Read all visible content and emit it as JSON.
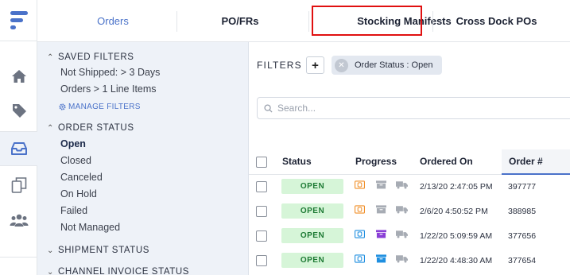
{
  "tabs": [
    {
      "label": "Orders",
      "active": true
    },
    {
      "label": "PO/FRs",
      "active": false
    },
    {
      "label": "Stocking Manifests",
      "active": false,
      "highlighted": true
    },
    {
      "label": "Cross Dock POs",
      "active": false
    }
  ],
  "rail": {
    "items": [
      {
        "icon": "home-icon"
      },
      {
        "icon": "tag-icon"
      },
      {
        "icon": "inbox-icon",
        "active": true
      },
      {
        "icon": "copy-icon"
      },
      {
        "icon": "users-icon"
      }
    ]
  },
  "sidebar": {
    "saved_filters": {
      "title": "SAVED FILTERS",
      "items": [
        "Not Shipped: > 3 Days",
        "Orders > 1 Line Items"
      ],
      "manage_label": "MANAGE FILTERS"
    },
    "order_status": {
      "title": "ORDER STATUS",
      "items": [
        "Open",
        "Closed",
        "Canceled",
        "On Hold",
        "Failed",
        "Not Managed"
      ],
      "selected": "Open"
    },
    "shipment_status": {
      "title": "SHIPMENT STATUS"
    },
    "channel_invoice_status": {
      "title": "CHANNEL INVOICE STATUS"
    }
  },
  "main": {
    "filters_label": "FILTERS",
    "add_label": "+",
    "chip_label": "Order Status : Open",
    "search_placeholder": "Search..."
  },
  "table": {
    "headers": {
      "status": "Status",
      "progress": "Progress",
      "ordered_on": "Ordered On",
      "order_num": "Order #"
    },
    "rows": [
      {
        "status": "OPEN",
        "ordered_on": "2/13/20 2:47:05 PM",
        "order_num": "397777",
        "progress": [
          "orange",
          "gray",
          "gray"
        ]
      },
      {
        "status": "OPEN",
        "ordered_on": "2/6/20 4:50:52 PM",
        "order_num": "388985",
        "progress": [
          "orange",
          "gray",
          "gray"
        ]
      },
      {
        "status": "OPEN",
        "ordered_on": "1/22/20 5:09:59 AM",
        "order_num": "377656",
        "progress": [
          "blue",
          "purple",
          "gray"
        ]
      },
      {
        "status": "OPEN",
        "ordered_on": "1/22/20 4:48:30 AM",
        "order_num": "377654",
        "progress": [
          "blue",
          "blue",
          "gray"
        ]
      }
    ]
  },
  "colors": {
    "accent": "#4a72c9",
    "open_badge_bg": "#d6f5d8",
    "open_badge_text": "#1d7a34",
    "highlight": "#e01010",
    "payment_orange": "#f0902a",
    "payment_blue": "#1f8fe0",
    "box_purple": "#8a3fd6",
    "box_blue": "#2aa7e6",
    "muted_gray": "#a7acb4"
  }
}
